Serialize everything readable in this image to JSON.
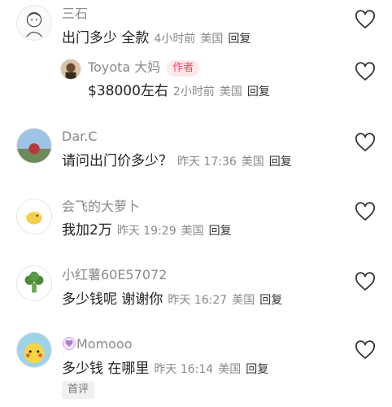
{
  "comments": [
    {
      "username": "三石",
      "text": "出门多少 全款",
      "time": "4小时前",
      "location": "美国",
      "reply": "回复"
    },
    {
      "username": "Toyota 大妈",
      "badge": "作者",
      "text": "$38000左右",
      "time": "2小时前",
      "location": "美国",
      "reply": "回复"
    },
    {
      "username": "Dar.C",
      "text": "请问出门价多少？",
      "time": "昨天 17:36",
      "location": "美国",
      "reply": "回复"
    },
    {
      "username": "会飞的大萝卜",
      "text": "我加2万",
      "time": "昨天 19:29",
      "location": "美国",
      "reply": "回复"
    },
    {
      "username": "小红薯60E57072",
      "text": "多少钱呢 谢谢你",
      "time": "昨天 16:27",
      "location": "美国",
      "reply": "回复"
    },
    {
      "username": "Momooo",
      "text": "多少钱 在哪里",
      "time": "昨天 16:14",
      "location": "美国",
      "reply": "回复",
      "tag": "首评"
    }
  ],
  "icons": {
    "like": "heart-outline-icon",
    "verified": "heart-small-icon"
  },
  "colors": {
    "author_badge_text": "#e8455a",
    "author_badge_bg": "#fde8ea",
    "meta": "#8a8a8a"
  }
}
